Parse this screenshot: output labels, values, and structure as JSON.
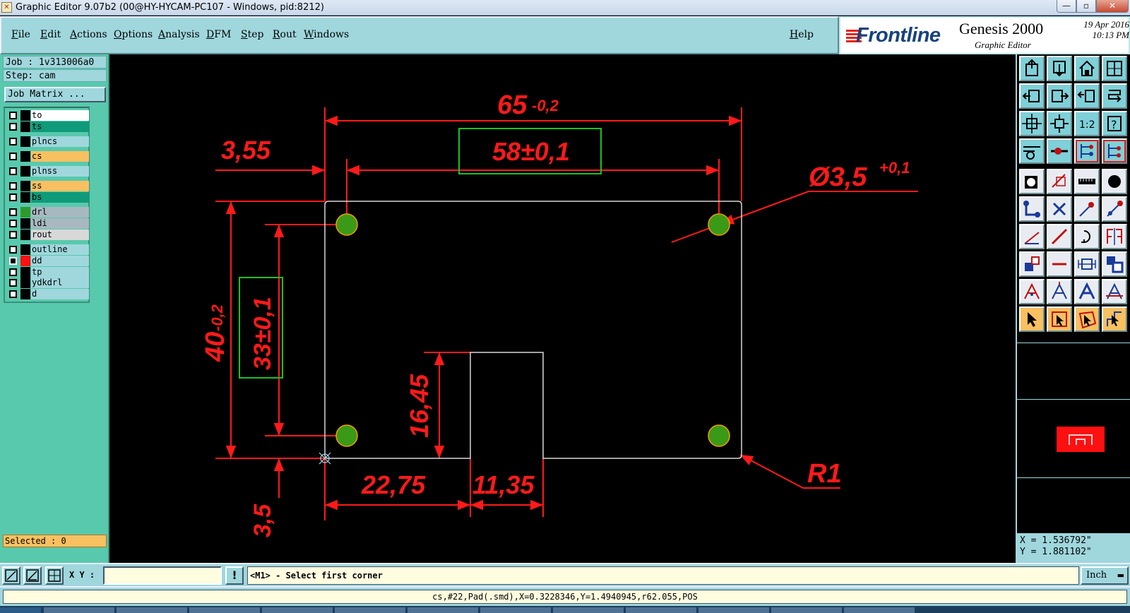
{
  "window": {
    "title": "Graphic Editor 9.07b2 (00@HY-HYCAM-PC107 - Windows, pid:8212)",
    "controls": {
      "minimize": "—",
      "maximize": "▫",
      "close": "✕"
    }
  },
  "menu": {
    "items": [
      "File",
      "Edit",
      "Actions",
      "Options",
      "Analysis",
      "DFM",
      "Step",
      "Rout",
      "Windows"
    ],
    "help": "Help"
  },
  "brand": {
    "logo": "Frontline",
    "product": "Genesis 2000",
    "subtitle": "Graphic Editor",
    "date": "19 Apr 2016",
    "time": "10:13 PM"
  },
  "job": {
    "job_line": "Job : 1v313006a0",
    "step_line": "Step: cam",
    "matrix_button": "Job Matrix ...",
    "selected": "Selected : 0"
  },
  "layers": [
    {
      "name": "to",
      "color": "#000000",
      "name_bg": "#ffffff"
    },
    {
      "name": "ts",
      "color": "#000000",
      "name_bg": "#0f9a7a"
    },
    {
      "name": "plncs",
      "color": "#000000",
      "name_bg": "#9fd7dd"
    },
    {
      "name": "cs",
      "color": "#000000",
      "name_bg": "#f8c060"
    },
    {
      "name": "plnss",
      "color": "#000000",
      "name_bg": "#9fd7dd"
    },
    {
      "name": "ss",
      "color": "#000000",
      "name_bg": "#f8c060"
    },
    {
      "name": "bs",
      "color": "#000000",
      "name_bg": "#0f9a7a"
    },
    {
      "name": "drl",
      "color": "#2e9a2e",
      "name_bg": "#a8b8c0"
    },
    {
      "name": "ldi",
      "color": "#000000",
      "name_bg": "#a8b8c0"
    },
    {
      "name": "rout",
      "color": "#000000",
      "name_bg": "#d8d8d8"
    },
    {
      "name": "outline",
      "color": "#000000",
      "name_bg": "#9fd7dd"
    },
    {
      "name": "dd",
      "color": "#ff1010",
      "name_bg": "#9fd7dd",
      "dark": true
    },
    {
      "name": "tp",
      "color": "#000000",
      "name_bg": "#9fd7dd"
    },
    {
      "name": "ydkdrl",
      "color": "#000000",
      "name_bg": "#9fd7dd"
    },
    {
      "name": "d",
      "color": "#000000",
      "name_bg": "#9fd7dd"
    }
  ],
  "drawing": {
    "dims": {
      "width_total": "65",
      "width_total_tol": "-0,2",
      "hole_spacing_x": "58±0,1",
      "left_offset": "3,55",
      "hole_dia": "Ø3,5",
      "hole_dia_tol": "+0,1",
      "height_total": "40",
      "height_total_tol": "-0,2",
      "hole_spacing_y": "33±0,1",
      "notch_height": "16,45",
      "notch_left": "22,75",
      "notch_width": "11,35",
      "bottom_offset": "3,5",
      "corner_radius": "R1"
    },
    "colors": {
      "dim": "#ff1a1a",
      "pad": "#3a9a18",
      "outline": "#d8d8d8",
      "box": "#20c020"
    }
  },
  "toolbar": {
    "tools": [
      "open-step-icon",
      "save-icon",
      "home-icon",
      "window-icon",
      "pan-left-icon",
      "pan-right-icon",
      "undo-view-icon",
      "redraw-icon",
      "zoom-fit-icon",
      "zoom-home-icon",
      "zoom-1to2-icon",
      "help-icon",
      "measure-icon",
      "snap-icon",
      "layer-select-icon",
      "layer-multi-icon",
      "pad-icon",
      "line-icon",
      "ruler-icon",
      "dot-icon",
      "connect-icon",
      "cross-icon",
      "arc-point-icon",
      "arc-point2-icon",
      "edit-line-icon",
      "draw-line-icon",
      "rotate-icon",
      "mirror-icon",
      "feature-icon",
      "minus-icon",
      "spacing-icon",
      "group-icon",
      "text-a-icon",
      "text-a2-icon",
      "text-a3-icon",
      "text-a4-icon",
      "select-arrow-icon",
      "select-box-icon",
      "select-poly-icon",
      "select-path-icon"
    ],
    "zoom_label": "1:2",
    "help_label": "?"
  },
  "coords": {
    "x": "X = 1.536792\"",
    "y": "Y = 1.881102\""
  },
  "command": {
    "xy_label": "X Y :",
    "xy_value": "",
    "info_button": "!",
    "prompt": "<M1> - Select first corner",
    "units": "Inch"
  },
  "status": "cs,#22,Pad(.smd),X=0.3228346,Y=1.4940945,r62.055,POS"
}
